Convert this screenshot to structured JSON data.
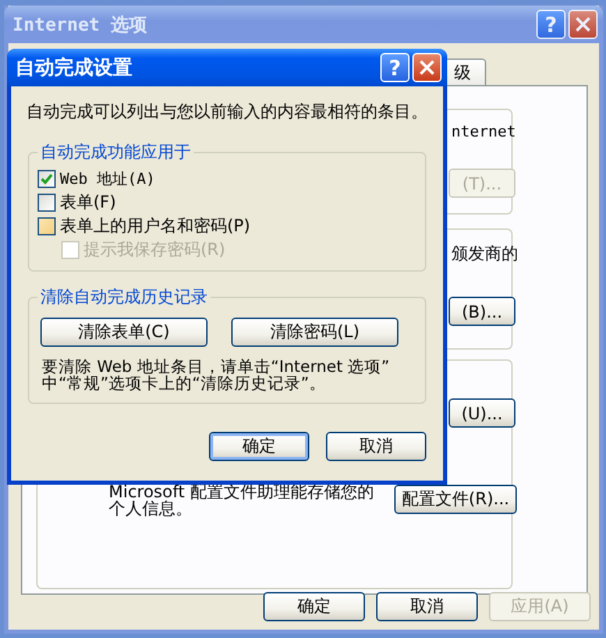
{
  "back_window": {
    "title": "Internet 选项",
    "help_label": "?",
    "tab_label": "级",
    "texts": [
      {
        "text": "nternet",
        "kind": "top"
      },
      {
        "text": "颁发商的",
        "kind": "mid"
      }
    ],
    "buttons": [
      {
        "label": "(T)...",
        "disabled": true
      },
      {
        "label": "(B)...",
        "disabled": false
      },
      {
        "label": "(U)...",
        "disabled": false
      }
    ],
    "profile_text": [
      "Microsoft 配置文件助理能存储您的",
      "个人信息。"
    ],
    "profile_button": "配置文件(R)...",
    "footer_buttons": [
      {
        "label": "确定",
        "disabled": false
      },
      {
        "label": "取消",
        "disabled": false
      },
      {
        "label": "应用(A)",
        "disabled": true
      }
    ]
  },
  "dialog": {
    "title": "自动完成设置",
    "help_label": "?",
    "description": "自动完成可以列出与您以前输入的内容最相符的条目。",
    "apply_group": {
      "legend": "自动完成功能应用于",
      "options": [
        {
          "label": "Web 地址(A)",
          "checked": true,
          "disabled": false,
          "hover": false
        },
        {
          "label": "表单(F)",
          "checked": false,
          "disabled": false,
          "hover": false
        },
        {
          "label": "表单上的用户名和密码(P)",
          "checked": false,
          "disabled": false,
          "hover": true,
          "children": [
            {
              "label": "提示我保存密码(R)",
              "checked": false,
              "disabled": true,
              "hover": false
            }
          ]
        }
      ]
    },
    "clear_group": {
      "legend": "清除自动完成历史记录",
      "buttons": [
        "清除表单(C)",
        "清除密码(L)"
      ],
      "note": [
        "要清除 Web 地址条目，请单击“Internet 选项”",
        "中“常规”选项卡上的“清除历史记录”。"
      ]
    },
    "buttons": [
      {
        "label": "确定",
        "default": true
      },
      {
        "label": "取消",
        "default": false
      }
    ]
  }
}
